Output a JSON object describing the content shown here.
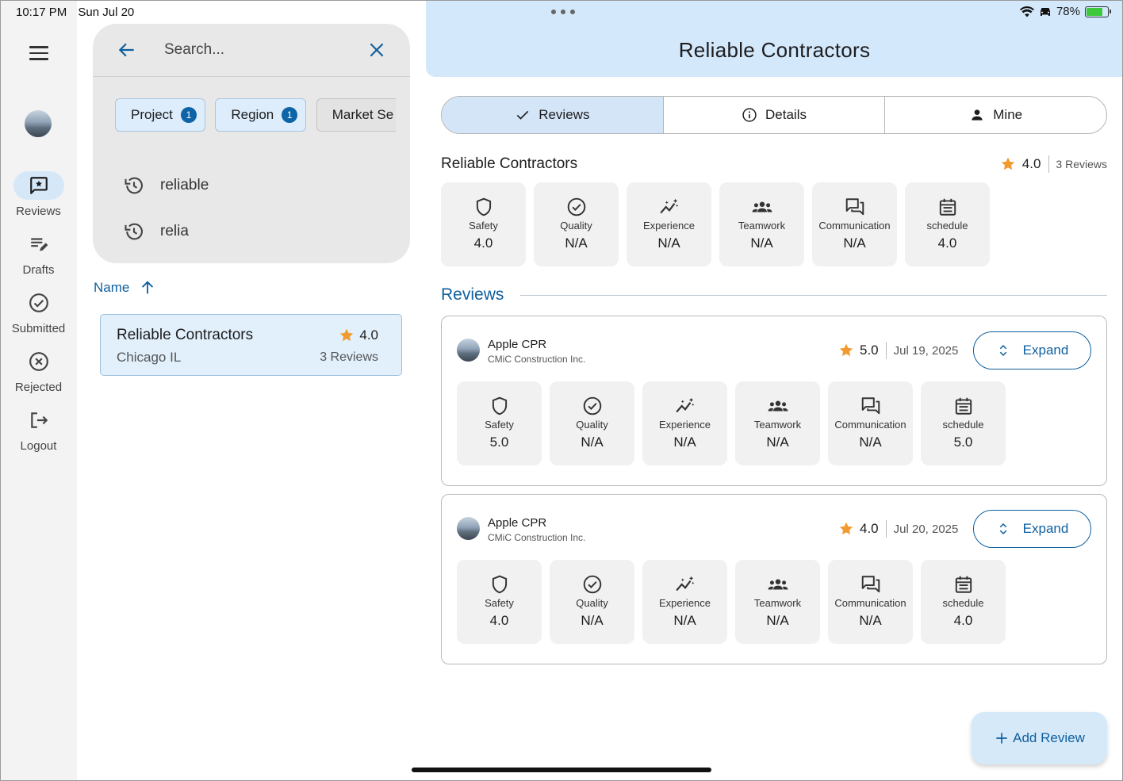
{
  "status_bar": {
    "time": "10:17 PM",
    "date": "Sun Jul 20",
    "battery": "78%",
    "battery_level": 0.78
  },
  "rail": {
    "items": [
      {
        "label": "Reviews",
        "icon": "reviews-icon",
        "active": true
      },
      {
        "label": "Drafts",
        "icon": "drafts-icon"
      },
      {
        "label": "Submitted",
        "icon": "check-circle-icon"
      },
      {
        "label": "Rejected",
        "icon": "x-circle-icon"
      },
      {
        "label": "Logout",
        "icon": "logout-icon"
      }
    ]
  },
  "search": {
    "placeholder": "Search...",
    "chips": [
      {
        "label": "Project",
        "badge": "1"
      },
      {
        "label": "Region",
        "badge": "1"
      },
      {
        "label": "Market Se"
      }
    ],
    "recent": [
      "reliable",
      "relia"
    ]
  },
  "sort": {
    "label": "Name"
  },
  "results": [
    {
      "name": "Reliable Contractors",
      "location": "Chicago IL",
      "rating": "4.0",
      "reviews": "3 Reviews"
    }
  ],
  "header": {
    "title": "Reliable Contractors"
  },
  "tabs": [
    {
      "label": "Reviews",
      "icon": "check-icon",
      "active": true
    },
    {
      "label": "Details",
      "icon": "info-icon"
    },
    {
      "label": "Mine",
      "icon": "person-icon"
    }
  ],
  "summary": {
    "title": "Reliable Contractors",
    "rating": "4.0",
    "count": "3 Reviews",
    "metrics": [
      {
        "label": "Safety",
        "value": "4.0",
        "icon": "shield-icon"
      },
      {
        "label": "Quality",
        "value": "N/A",
        "icon": "check-circle-icon"
      },
      {
        "label": "Experience",
        "value": "N/A",
        "icon": "experience-icon"
      },
      {
        "label": "Teamwork",
        "value": "N/A",
        "icon": "group-icon"
      },
      {
        "label": "Communication",
        "value": "N/A",
        "icon": "chat-icon"
      },
      {
        "label": "schedule",
        "value": "4.0",
        "icon": "calendar-icon"
      }
    ]
  },
  "reviews_section": {
    "title": "Reviews"
  },
  "reviews": [
    {
      "name": "Apple CPR",
      "company": "CMiC Construction Inc.",
      "rating": "5.0",
      "date": "Jul 19, 2025",
      "expand": "Expand",
      "metrics": [
        {
          "label": "Safety",
          "value": "5.0"
        },
        {
          "label": "Quality",
          "value": "N/A"
        },
        {
          "label": "Experience",
          "value": "N/A"
        },
        {
          "label": "Teamwork",
          "value": "N/A"
        },
        {
          "label": "Communication",
          "value": "N/A"
        },
        {
          "label": "schedule",
          "value": "5.0"
        }
      ]
    },
    {
      "name": "Apple CPR",
      "company": "CMiC Construction Inc.",
      "rating": "4.0",
      "date": "Jul 20, 2025",
      "expand": "Expand",
      "metrics": [
        {
          "label": "Safety",
          "value": "4.0"
        },
        {
          "label": "Quality",
          "value": "N/A"
        },
        {
          "label": "Experience",
          "value": "N/A"
        },
        {
          "label": "Teamwork",
          "value": "N/A"
        },
        {
          "label": "Communication",
          "value": "N/A"
        },
        {
          "label": "schedule",
          "value": "4.0"
        }
      ]
    }
  ],
  "fab": {
    "label": "Add Review"
  },
  "colors": {
    "accent": "#0e5f9e",
    "header_bg": "#d3e8fb",
    "star": "#f29a2e"
  }
}
